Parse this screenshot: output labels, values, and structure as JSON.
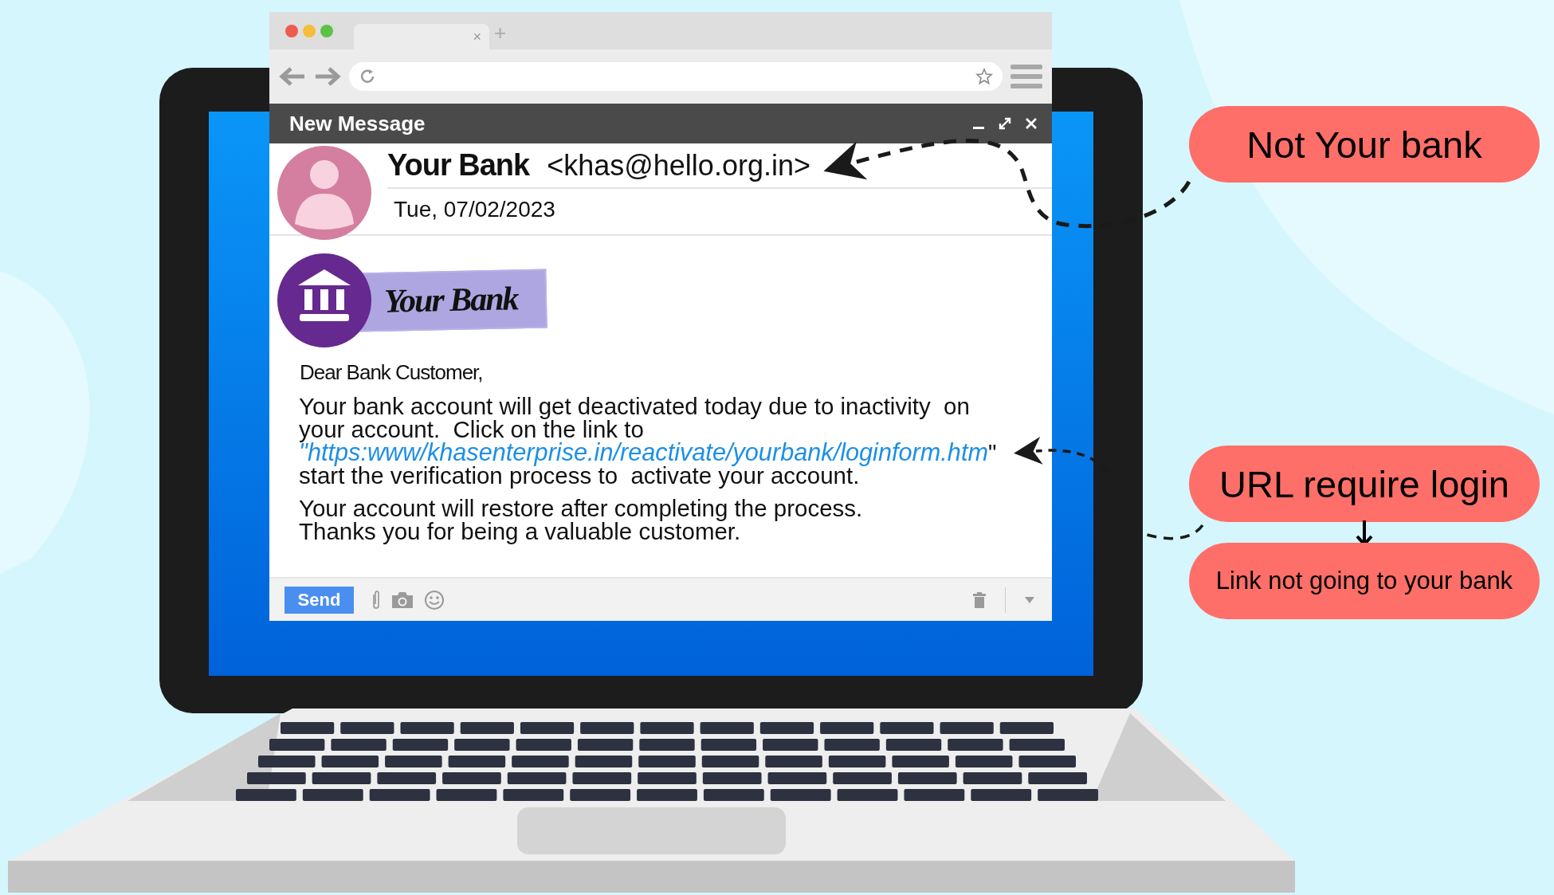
{
  "browser": {
    "tab_close": "×",
    "new_tab": "+"
  },
  "message_window": {
    "title": "New Message"
  },
  "email": {
    "sender_name": "Your Bank",
    "sender_address": "<khas@hello.org.in>",
    "date": "Tue, 07/02/2023",
    "logo_text": "Your Bank",
    "greeting": "Dear Bank Customer,",
    "paragraphs": [
      {
        "kind": "link",
        "lines_before": [
          "Your bank account will get deactivated today due to inactivity  on",
          "your account.  Click on the link to"
        ],
        "link": "\"https:www/khasenterprise.in/reactivate/yourbank/loginform.htm",
        "after_link": "\"",
        "lines_after": [
          "start the verification process to  activate your account."
        ]
      },
      {
        "kind": "plain",
        "lines_before": [
          "Your account will restore after completing the process.",
          "Thanks you for being a valuable customer."
        ]
      }
    ]
  },
  "footer": {
    "send_button": "Send"
  },
  "callouts": [
    {
      "text": "Not Your bank",
      "kind": "large"
    },
    {
      "text": "URL require login",
      "kind": "large"
    },
    {
      "text": "Link not going to your bank",
      "kind": "small"
    }
  ]
}
